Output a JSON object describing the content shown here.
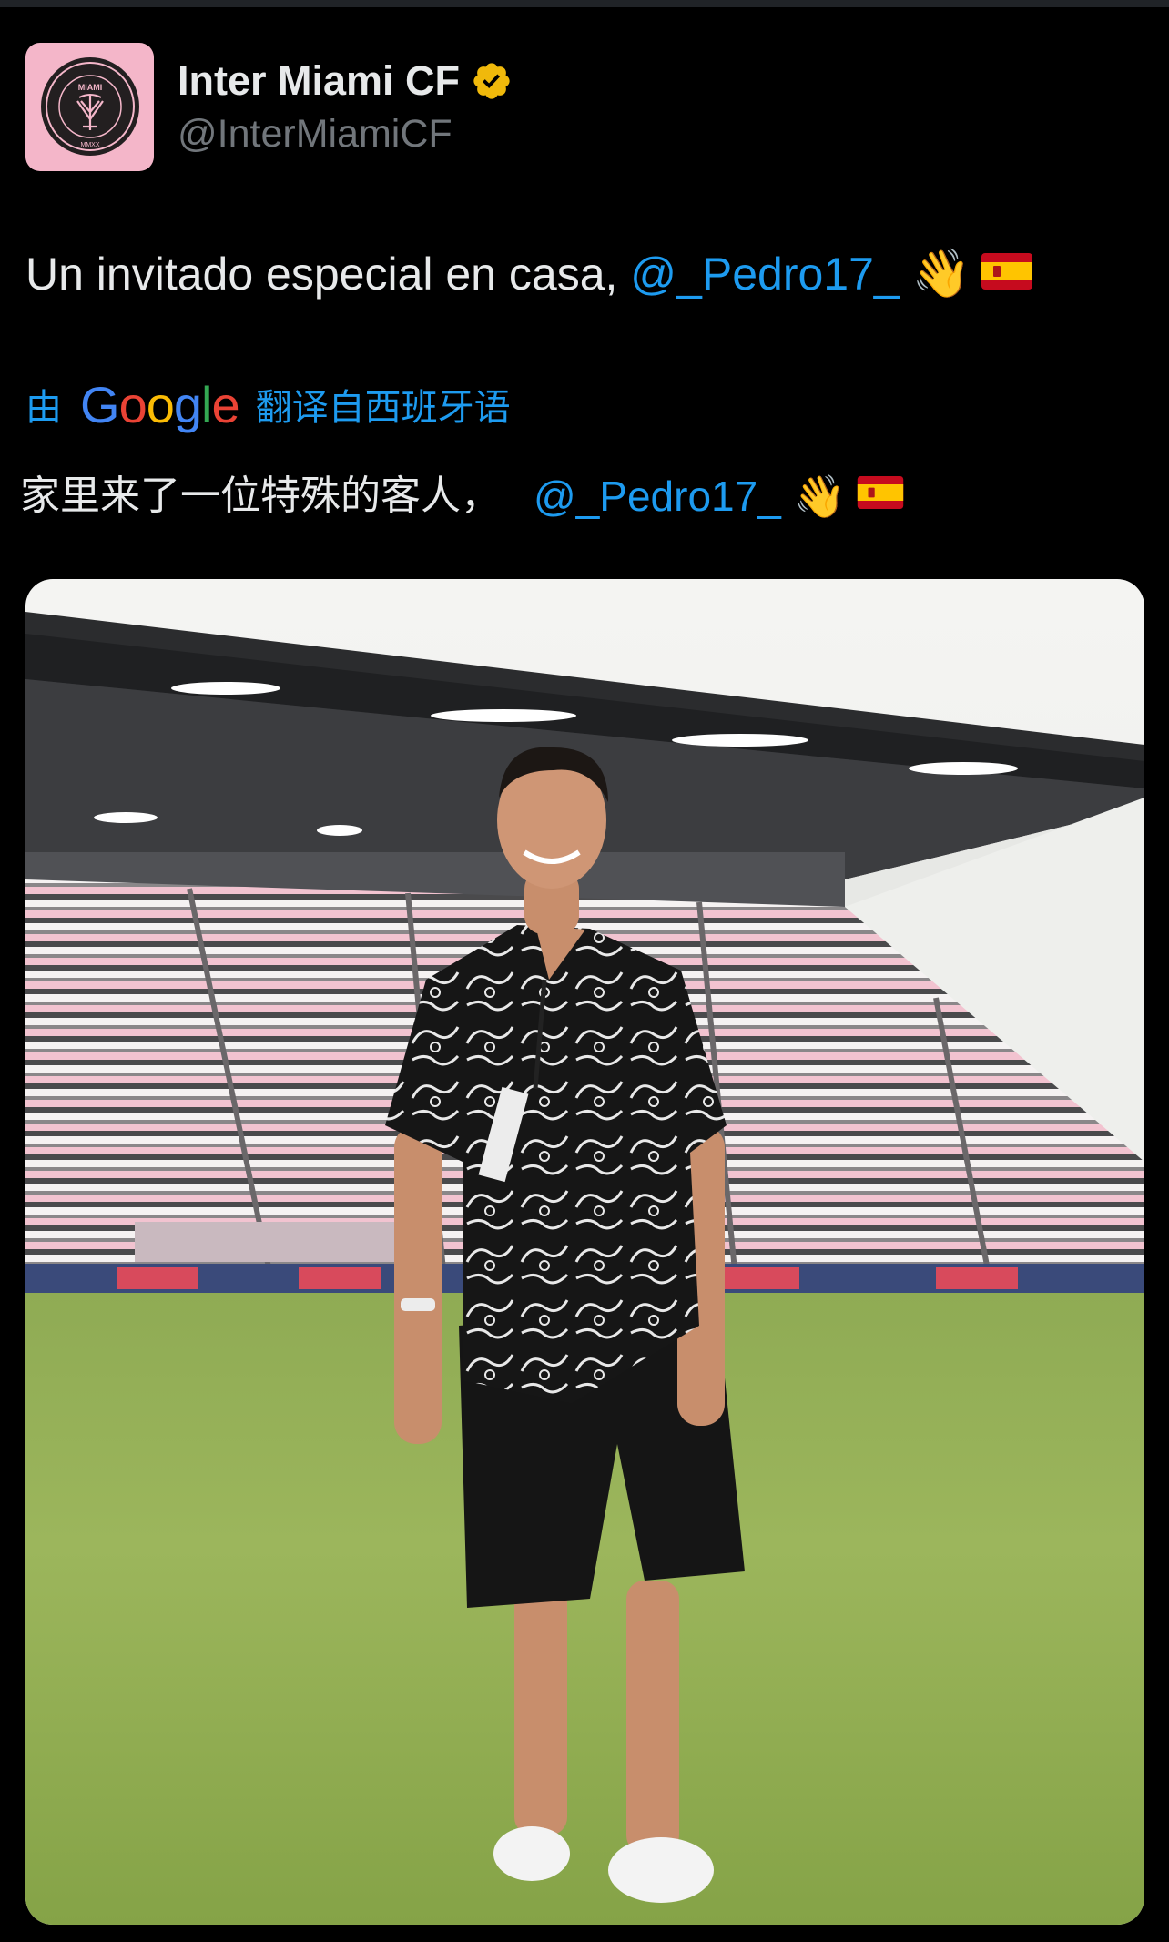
{
  "app": {
    "accent_color": "#1d9bf0",
    "background_color": "#000000"
  },
  "author": {
    "display_name": "Inter Miami CF",
    "handle": "@InterMiamiCF",
    "verified": true,
    "verified_badge_color": "#f0b90b",
    "avatar_icon": "inter-miami-crest-icon",
    "avatar_bg_color": "#f4b6c9",
    "crest_text": {
      "top": "MIAMI",
      "ring": "CLUB INTERNACIONAL DE FUTBOL",
      "bottom": "MMXX"
    }
  },
  "tweet": {
    "text_before_mention": "Un invitado especial en casa, ",
    "mention": "@_Pedro17_",
    "emoji_wave": "👋",
    "emoji_flag": "spain-flag-icon"
  },
  "translation": {
    "prefix": "由",
    "provider": "Google",
    "suffix": "翻译自西班牙语",
    "text_before_mention": "家里来了一位特殊的客人，",
    "mention": "@_Pedro17_",
    "emoji_wave": "👋",
    "emoji_flag": "spain-flag-icon"
  },
  "media": {
    "type": "photo",
    "subject": "player-standing-on-pitch-photo"
  }
}
